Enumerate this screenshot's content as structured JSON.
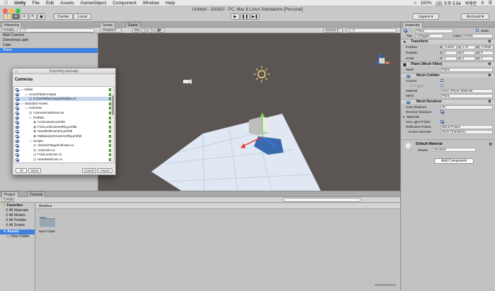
{
  "menubar": {
    "apple": "",
    "items": [
      "Unity",
      "File",
      "Edit",
      "Assets",
      "GameObject",
      "Component",
      "Window",
      "Help"
    ],
    "tray": {
      "battery": "100%",
      "clock": "(금) 오후 5:54",
      "user": "박해란"
    }
  },
  "window": {
    "title": "Untitled - 150810 - PC, Mac & Linux Standalone [Personal]"
  },
  "toolbar": {
    "center_label": "Center",
    "local_label": "Local",
    "layers_label": "Layers",
    "layout_label": "Account"
  },
  "hierarchy": {
    "tab": "Hierarchy",
    "create_label": "Create",
    "search_placeholder": "Q·All",
    "items": [
      "Main Camera",
      "Directional Light",
      "Cube",
      "Plane"
    ],
    "selected_index": 3
  },
  "scene": {
    "tab_scene": "Scene",
    "tab_game": "Game",
    "shading": "Shaded",
    "mode_2d": "2D",
    "gizmos": "Gizmos",
    "search": "Q·All",
    "persp_label": "< Persp"
  },
  "import_dialog": {
    "title": "Importing package",
    "heading": "Cameras",
    "items": [
      {
        "label": "Editor",
        "indent": 0,
        "type": "folder",
        "new": true
      },
      {
        "label": "CrossPlatformInput",
        "indent": 1,
        "type": "folder",
        "new": true
      },
      {
        "label": "CrossPlatformInputInitialize.cs",
        "indent": 2,
        "type": "script",
        "new": true,
        "selected": true
      },
      {
        "label": "Standard Assets",
        "indent": 0,
        "type": "folder",
        "new": true
      },
      {
        "label": "Cameras",
        "indent": 1,
        "type": "folder",
        "new": true
      },
      {
        "label": "CameraGuidelines.txt",
        "indent": 2,
        "type": "text",
        "new": true
      },
      {
        "label": "Prefabs",
        "indent": 2,
        "type": "folder",
        "new": true
      },
      {
        "label": "CctvCamera.prefab",
        "indent": 3,
        "type": "prefab",
        "new": true
      },
      {
        "label": "FreeLookCameraRig.prefab",
        "indent": 3,
        "type": "prefab",
        "new": true
      },
      {
        "label": "HandheldCamera.prefab",
        "indent": 3,
        "type": "prefab",
        "new": true
      },
      {
        "label": "MultipurposeCameraRig.prefab",
        "indent": 3,
        "type": "prefab",
        "new": true
      },
      {
        "label": "Scripts",
        "indent": 2,
        "type": "folder",
        "new": true
      },
      {
        "label": "AbstractTargetFollower.cs",
        "indent": 3,
        "type": "script",
        "new": true
      },
      {
        "label": "AutoCam.cs",
        "indent": 3,
        "type": "script",
        "new": true
      },
      {
        "label": "FreeLookCam.cs",
        "indent": 3,
        "type": "script",
        "new": true
      },
      {
        "label": "HandHeldCam.cs",
        "indent": 3,
        "type": "script",
        "new": true
      }
    ],
    "all_label": "All",
    "none_label": "None",
    "cancel_label": "Cancel",
    "import_label": "Import"
  },
  "inspector": {
    "tab": "Inspector",
    "object_name": "Plane",
    "static_label": "Static",
    "tag_label": "Tag",
    "tag_value": "Untagged",
    "layer_label": "Layer",
    "layer_value": "Default",
    "transform": {
      "title": "Transform",
      "position": {
        "label": "Position",
        "x": "-1.8110",
        "y": "1.27",
        "z": "-0.0030"
      },
      "rotation": {
        "label": "Rotation",
        "x": "0",
        "y": "0",
        "z": "0"
      },
      "scale": {
        "label": "Scale",
        "x": "1",
        "y": "1",
        "z": "1"
      }
    },
    "mesh_filter": {
      "title": "Plane (Mesh Filter)",
      "mesh_label": "Mesh",
      "mesh_value": "Plane"
    },
    "mesh_collider": {
      "title": "Mesh Collider",
      "convex_label": "Convex",
      "is_trigger_label": "Is Trigger",
      "material_label": "Material",
      "material_value": "None (Physic Material)",
      "mesh_label": "Mesh",
      "mesh_value": "Plane"
    },
    "mesh_renderer": {
      "title": "Mesh Renderer",
      "cast_shadows_label": "Cast Shadows",
      "cast_shadows_value": "On",
      "receive_shadows_label": "Receive Shadows",
      "materials_label": "Materials",
      "use_light_probes_label": "Use Light Probes",
      "reflection_probes_label": "Reflection Probes",
      "reflection_probes_value": "Blend Probes",
      "anchor_override_label": "Anchor Override",
      "anchor_override_value": "None (Transform)"
    },
    "material": {
      "name": "Default-Material",
      "shader_label": "Shader",
      "shader_value": "Standard"
    },
    "add_component_label": "Add Component"
  },
  "project": {
    "tab_project": "Project",
    "tab_console": "Console",
    "create_label": "Create",
    "favorites_label": "Favorites",
    "favorites": [
      "All Materials",
      "All Models",
      "All Prefabs",
      "All Scripts"
    ],
    "assets_label": "Assets",
    "assets_children": [
      "New Folder"
    ],
    "breadcrumb": "Assets",
    "grid_items": [
      "New Folder"
    ]
  },
  "colors": {
    "selection": "#3d80df",
    "scene_bg": "#5b5553",
    "plane": "#dfe8f3",
    "cube": "#c9c9c9",
    "new_badge": "#5fb043"
  }
}
